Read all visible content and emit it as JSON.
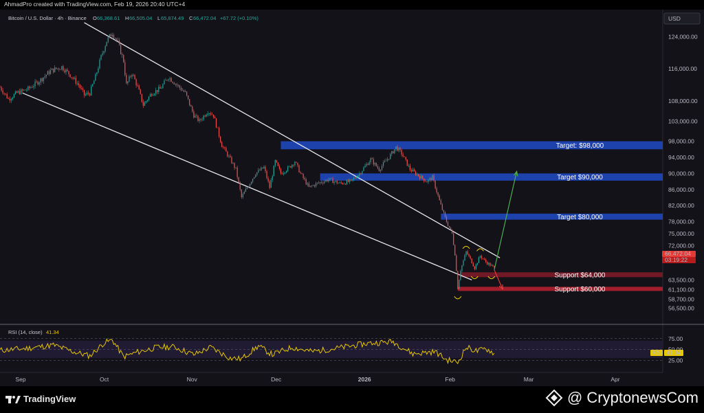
{
  "header": {
    "caption": "AhmadPro created with TradingView.com, Feb 19, 2026 20:40 UTC+4"
  },
  "legend": {
    "symbol": "Bitcoin / U.S. Dollar · 4h · Binance",
    "o_label": "O",
    "o_value": "66,368.61",
    "h_label": "H",
    "h_value": "66,505.04",
    "l_label": "L",
    "l_value": "65,874.49",
    "c_label": "C",
    "c_value": "66,472.04",
    "change": "+67.72 (+0.10%)"
  },
  "price_axis": {
    "currency": "USD",
    "ticks": [
      "124,000.00",
      "116,000.00",
      "108,000.00",
      "103,000.00",
      "98,000.00",
      "94,000.00",
      "90,000.00",
      "86,000.00",
      "82,000.00",
      "78,000.00",
      "75,000.00",
      "72,000.00",
      "69,000.00",
      "63,500.00",
      "61,100.00",
      "58,700.00",
      "56,500.00"
    ],
    "last_price": "66,472.04",
    "countdown": "03:19:22"
  },
  "time_axis": {
    "labels": [
      "Sep",
      "Oct",
      "Nov",
      "Dec",
      "2026",
      "Feb",
      "Mar",
      "Apr"
    ]
  },
  "rsi": {
    "title": "RSI (14, close)",
    "value": "41.34",
    "tag_label": "RSI",
    "ticks": [
      "75.00",
      "50.00",
      "25.00"
    ]
  },
  "annotations": {
    "zones": [
      {
        "label": "Target: $98,000",
        "color": "#1f47b8"
      },
      {
        "label": "Target $90,000",
        "color": "#1f47b8"
      },
      {
        "label": "Target $80,000",
        "color": "#1f47b8"
      },
      {
        "label": "Support $64,000",
        "color": "#7a1a28"
      },
      {
        "label": "Support $60,000",
        "color": "#b0202e"
      }
    ]
  },
  "colors": {
    "background": "#141219",
    "candle_up": "#26a69a",
    "candle_down": "#ef5350",
    "rsi_line": "#e6c700",
    "target_zone": "#1f47b8",
    "support_zone": "#b0202e",
    "bullish_arrow": "#4caf50",
    "bearish_arrow": "#e53935"
  },
  "chart_data": {
    "type": "candlestick",
    "title": "Bitcoin / U.S. Dollar · 4h · Binance",
    "x_range": [
      "2025-08-27",
      "2026-04-20"
    ],
    "y_range": [
      54000,
      128000
    ],
    "price_path": [
      [
        "2025-08-27",
        111500
      ],
      [
        "2025-08-30",
        108500
      ],
      [
        "2025-09-02",
        110000
      ],
      [
        "2025-09-06",
        111000
      ],
      [
        "2025-09-10",
        113000
      ],
      [
        "2025-09-14",
        115500
      ],
      [
        "2025-09-18",
        116500
      ],
      [
        "2025-09-21",
        114500
      ],
      [
        "2025-09-24",
        112000
      ],
      [
        "2025-09-26",
        109500
      ],
      [
        "2025-09-28",
        110000
      ],
      [
        "2025-09-30",
        114000
      ],
      [
        "2025-10-02",
        119000
      ],
      [
        "2025-10-04",
        123000
      ],
      [
        "2025-10-06",
        125000
      ],
      [
        "2025-10-08",
        122500
      ],
      [
        "2025-10-10",
        118000
      ],
      [
        "2025-10-11",
        112000
      ],
      [
        "2025-10-13",
        115000
      ],
      [
        "2025-10-15",
        111500
      ],
      [
        "2025-10-17",
        107000
      ],
      [
        "2025-10-20",
        110000
      ],
      [
        "2025-10-23",
        111000
      ],
      [
        "2025-10-26",
        114000
      ],
      [
        "2025-10-29",
        112000
      ],
      [
        "2025-11-01",
        110000
      ],
      [
        "2025-11-04",
        104500
      ],
      [
        "2025-11-06",
        103000
      ],
      [
        "2025-11-09",
        105500
      ],
      [
        "2025-11-11",
        104500
      ],
      [
        "2025-11-14",
        97000
      ],
      [
        "2025-11-17",
        93500
      ],
      [
        "2025-11-19",
        91000
      ],
      [
        "2025-11-21",
        84000
      ],
      [
        "2025-11-23",
        86500
      ],
      [
        "2025-11-26",
        90000
      ],
      [
        "2025-11-29",
        91500
      ],
      [
        "2025-12-01",
        86500
      ],
      [
        "2025-12-03",
        93000
      ],
      [
        "2025-12-05",
        90000
      ],
      [
        "2025-12-08",
        91500
      ],
      [
        "2025-12-10",
        93000
      ],
      [
        "2025-12-12",
        90000
      ],
      [
        "2025-12-15",
        86500
      ],
      [
        "2025-12-18",
        87500
      ],
      [
        "2025-12-22",
        88500
      ],
      [
        "2025-12-26",
        87500
      ],
      [
        "2025-12-30",
        88000
      ],
      [
        "2026-01-02",
        90000
      ],
      [
        "2026-01-06",
        93500
      ],
      [
        "2026-01-09",
        91000
      ],
      [
        "2026-01-13",
        94500
      ],
      [
        "2026-01-15",
        96500
      ],
      [
        "2026-01-17",
        95000
      ],
      [
        "2026-01-20",
        91000
      ],
      [
        "2026-01-23",
        89500
      ],
      [
        "2026-01-26",
        88000
      ],
      [
        "2026-01-28",
        89000
      ],
      [
        "2026-01-31",
        82000
      ],
      [
        "2026-02-02",
        78000
      ],
      [
        "2026-02-04",
        75000
      ],
      [
        "2026-02-05",
        70000
      ],
      [
        "2026-02-06",
        61500
      ],
      [
        "2026-02-07",
        66000
      ],
      [
        "2026-02-09",
        70500
      ],
      [
        "2026-02-11",
        68000
      ],
      [
        "2026-02-12",
        66500
      ],
      [
        "2026-02-14",
        69500
      ],
      [
        "2026-02-16",
        68000
      ],
      [
        "2026-02-18",
        67000
      ],
      [
        "2026-02-19",
        66472
      ]
    ],
    "last": {
      "open": 66368.61,
      "high": 66505.04,
      "low": 65874.49,
      "close": 66472.04,
      "change": 67.72,
      "change_pct": 0.1
    },
    "channel": {
      "upper": [
        [
          "2025-09-26",
          127500
        ],
        [
          "2026-02-21",
          69000
        ]
      ],
      "lower": [
        [
          "2025-09-04",
          110000
        ],
        [
          "2026-02-11",
          63500
        ]
      ]
    },
    "zones": [
      {
        "label": "Target: $98,000",
        "from": "2025-12-05",
        "to": "2026-04-20",
        "y_low": 96000,
        "y_high": 98000
      },
      {
        "label": "Target $90,000",
        "from": "2025-12-19",
        "to": "2026-04-20",
        "y_low": 88200,
        "y_high": 90000
      },
      {
        "label": "Target $80,000",
        "from": "2026-01-31",
        "to": "2026-04-20",
        "y_low": 78500,
        "y_high": 80000
      },
      {
        "label": "Support $64,000",
        "from": "2026-02-07",
        "to": "2026-04-20",
        "y_low": 64200,
        "y_high": 65400
      },
      {
        "label": "Support $60,000",
        "from": "2026-02-06",
        "to": "2026-04-20",
        "y_low": 60800,
        "y_high": 61800
      }
    ],
    "arrows": [
      {
        "direction": "up",
        "from": [
          "2026-02-19",
          66000
        ],
        "to": [
          "2026-02-27",
          90500
        ]
      },
      {
        "direction": "down",
        "from": [
          "2026-02-19",
          66000
        ],
        "to": [
          "2026-02-22",
          61200
        ]
      }
    ],
    "rsi": {
      "period": 14,
      "range": [
        0,
        100
      ],
      "band": [
        30,
        70
      ],
      "levels": [
        75,
        50,
        25
      ],
      "last": 41.34,
      "points": [
        [
          "2025-08-27",
          48
        ],
        [
          "2025-09-05",
          52
        ],
        [
          "2025-09-15",
          60
        ],
        [
          "2025-09-22",
          45
        ],
        [
          "2025-09-28",
          35
        ],
        [
          "2025-10-03",
          65
        ],
        [
          "2025-10-06",
          72
        ],
        [
          "2025-10-10",
          33
        ],
        [
          "2025-10-15",
          44
        ],
        [
          "2025-10-22",
          55
        ],
        [
          "2025-10-28",
          56
        ],
        [
          "2025-11-04",
          38
        ],
        [
          "2025-11-10",
          55
        ],
        [
          "2025-11-17",
          30
        ],
        [
          "2025-11-21",
          28
        ],
        [
          "2025-11-27",
          58
        ],
        [
          "2025-12-02",
          38
        ],
        [
          "2025-12-09",
          55
        ],
        [
          "2025-12-16",
          45
        ],
        [
          "2025-12-24",
          52
        ],
        [
          "2026-01-05",
          64
        ],
        [
          "2026-01-14",
          68
        ],
        [
          "2026-01-21",
          40
        ],
        [
          "2026-01-29",
          45
        ],
        [
          "2026-02-02",
          26
        ],
        [
          "2026-02-06",
          20
        ],
        [
          "2026-02-09",
          55
        ],
        [
          "2026-02-13",
          46
        ],
        [
          "2026-02-16",
          52
        ],
        [
          "2026-02-19",
          41.34
        ]
      ]
    }
  }
}
